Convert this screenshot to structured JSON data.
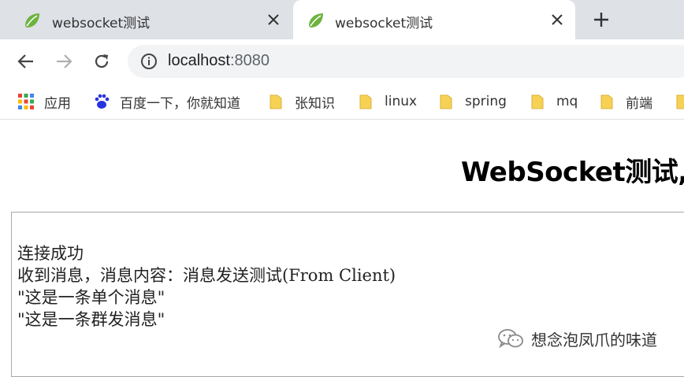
{
  "tabs": [
    {
      "title": "websocket测试",
      "active": false
    },
    {
      "title": "websocket测试",
      "active": true
    }
  ],
  "address_bar": {
    "host": "localhost",
    "port": ":8080"
  },
  "bookmarks": [
    {
      "label": "应用",
      "icon": "apps-grid-icon"
    },
    {
      "label": "百度一下，你就知道",
      "icon": "baidu-icon"
    },
    {
      "label": "张知识",
      "icon": "folder-icon"
    },
    {
      "label": "linux",
      "icon": "folder-icon"
    },
    {
      "label": "spring",
      "icon": "folder-icon"
    },
    {
      "label": "mq",
      "icon": "folder-icon"
    },
    {
      "label": "前端",
      "icon": "folder-icon"
    }
  ],
  "page": {
    "heading": "WebSocket测试,",
    "messages": [
      "连接成功",
      "收到消息，消息内容：消息发送测试(From Client)",
      "\"这是一条单个消息\"",
      "\"这是一条群发消息\""
    ]
  },
  "watermark": {
    "text": "想念泡凤爪的味道"
  },
  "colors": {
    "tabstrip": "#dee1e6",
    "omnibox": "#f1f3f4",
    "folder": "#f7d154",
    "spring_leaf": "#6db33f"
  }
}
